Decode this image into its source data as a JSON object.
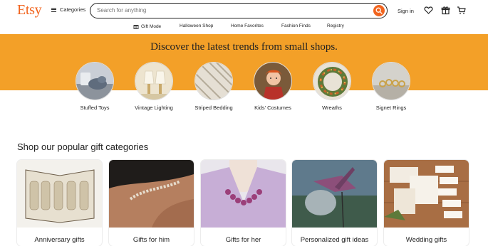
{
  "header": {
    "logo": "Etsy",
    "categories_label": "Categories",
    "search_placeholder": "Search for anything",
    "signin_label": "Sign in"
  },
  "subnav": [
    {
      "label": "Gift Mode",
      "icon": "gift-icon"
    },
    {
      "label": "Halloween Shop"
    },
    {
      "label": "Home Favorites"
    },
    {
      "label": "Fashion Finds"
    },
    {
      "label": "Registry"
    }
  ],
  "banner": {
    "title": "Discover the latest trends from small shops.",
    "color": "#F3A028"
  },
  "trends": [
    {
      "label": "Stuffed Toys"
    },
    {
      "label": "Vintage Lighting"
    },
    {
      "label": "Striped Bedding"
    },
    {
      "label": "Kids' Costumes"
    },
    {
      "label": "Wreaths"
    },
    {
      "label": "Signet Rings"
    }
  ],
  "gift_section": {
    "title": "Shop our popular gift categories",
    "cards": [
      {
        "label": "Anniversary gifts"
      },
      {
        "label": "Gifts for him"
      },
      {
        "label": "Gifts for her"
      },
      {
        "label": "Personalized gift ideas"
      },
      {
        "label": "Wedding gifts"
      }
    ]
  },
  "colors": {
    "brand": "#F1641E"
  }
}
